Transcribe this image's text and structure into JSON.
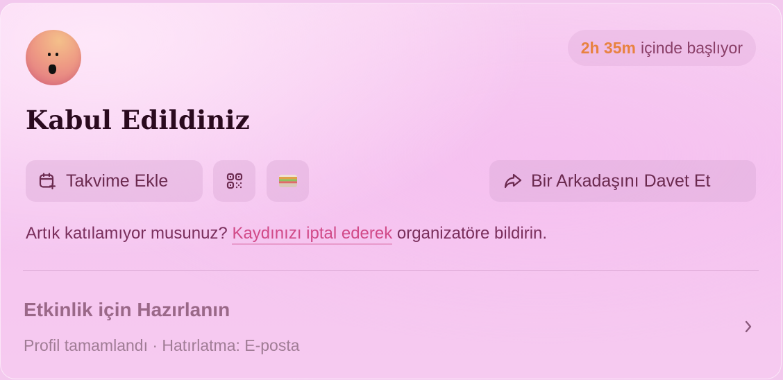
{
  "status_badge": {
    "time": "2h 35m",
    "suffix": "içinde başlıyor"
  },
  "title": "Kabul Edildiniz",
  "actions": {
    "add_to_calendar": "Takvime Ekle",
    "qr_icon": "qr-code-icon",
    "wallet_icon": "wallet-icon",
    "invite_friend": "Bir Arkadaşını Davet Et"
  },
  "cancel": {
    "prefix": "Artık katılamıyor musunuz?",
    "link": "Kaydınızı iptal ederek",
    "suffix": "organizatöre bildirin."
  },
  "prepare": {
    "title": "Etkinlik için Hazırlanın",
    "subtitle": "Profil tamamlandı · Hatırlatma: E-posta"
  },
  "colors": {
    "accent_time": "#e88240",
    "link": "#d14a88",
    "card_bg": "#f5c5f0"
  }
}
